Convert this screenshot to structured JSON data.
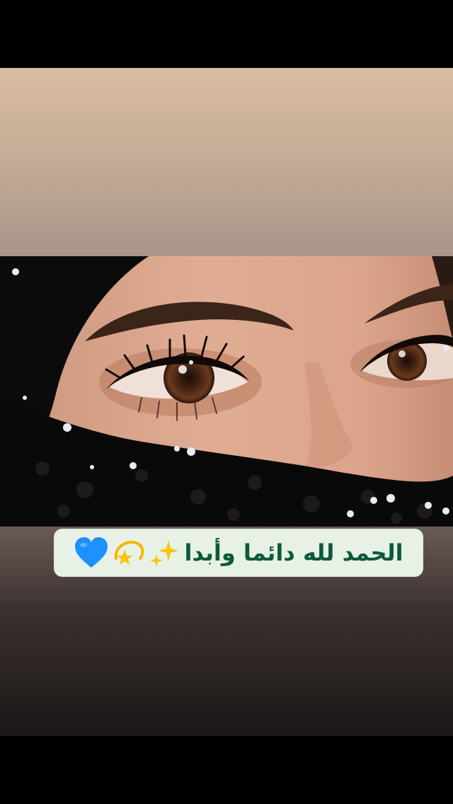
{
  "caption": {
    "text": "الحمد لله دائما وأبدا",
    "emojis": [
      "sparkles-icon",
      "dizzy-star-icon",
      "blue-heart-icon"
    ]
  },
  "colors": {
    "caption_bg": "#e7f1e6",
    "caption_text": "#0d5a3a",
    "top_background": "#d8bca2",
    "bottom_background": "#3b3230",
    "heart": "#1e90ff",
    "star": "#f7c600"
  },
  "photo": {
    "subject": "close-up of eyes above black knitted scarf with snowflakes"
  }
}
